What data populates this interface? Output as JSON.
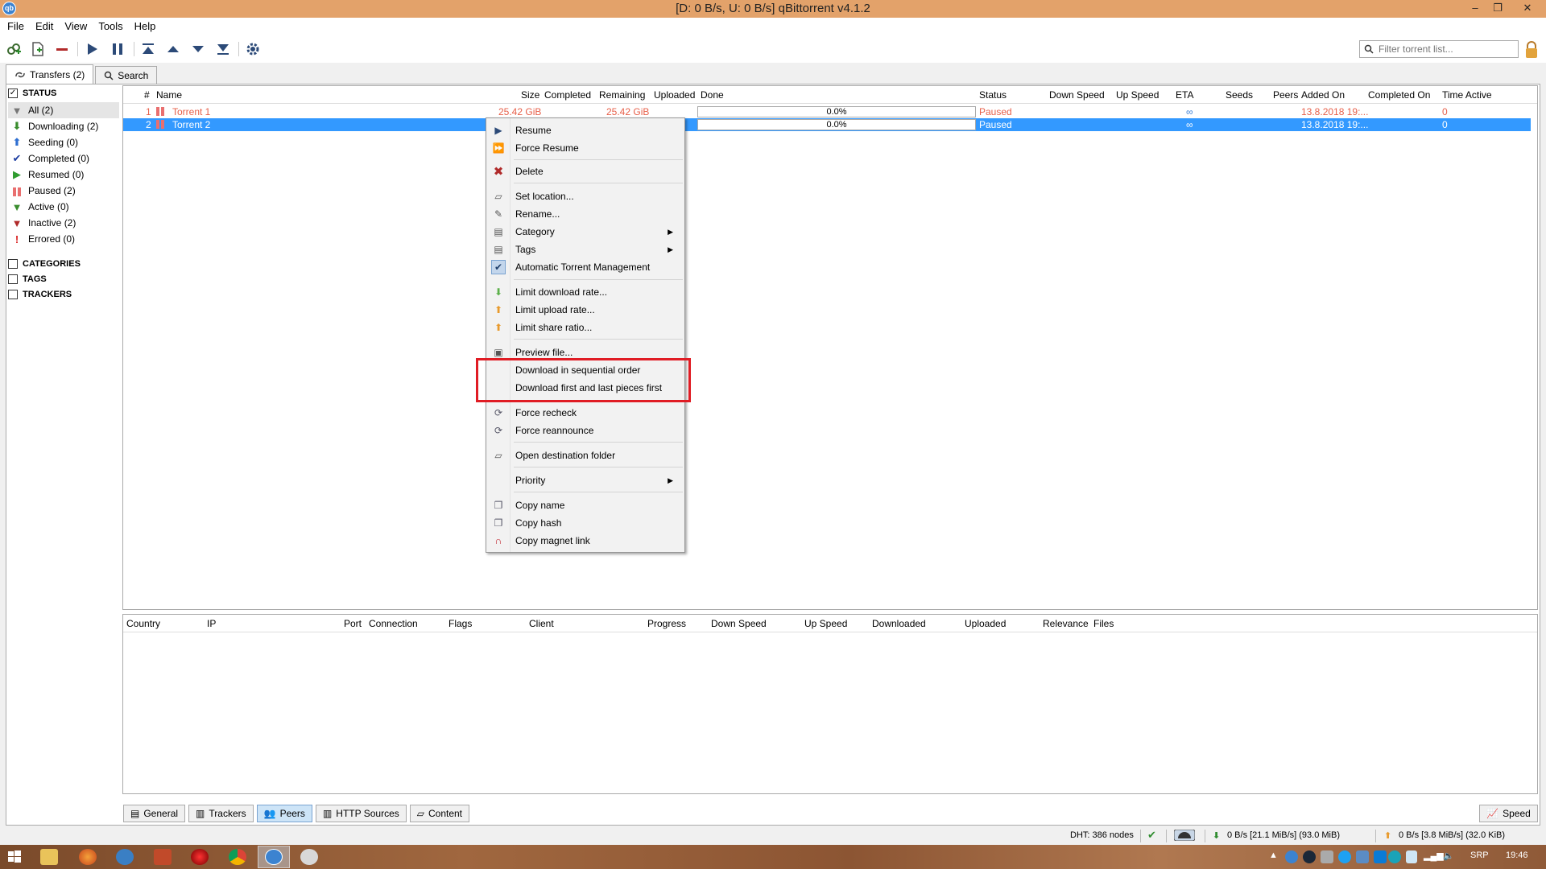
{
  "window": {
    "title": "[D: 0 B/s, U: 0 B/s] qBittorrent v4.1.2",
    "minimize": "–",
    "maximize": "❐",
    "close": "✕"
  },
  "menu": [
    "File",
    "Edit",
    "View",
    "Tools",
    "Help"
  ],
  "toolbar": {
    "filter_placeholder": "Filter torrent list..."
  },
  "tabs_top": [
    {
      "label": "Transfers (2)"
    },
    {
      "label": "Search"
    }
  ],
  "sidebar": {
    "status_header": "STATUS",
    "status_items": [
      {
        "label": "All (2)",
        "icon": "filter-icon",
        "color": "#777777"
      },
      {
        "label": "Downloading (2)",
        "icon": "down-arrow-icon",
        "color": "#3a8d2e"
      },
      {
        "label": "Seeding (0)",
        "icon": "up-arrow-icon",
        "color": "#2f6fd1"
      },
      {
        "label": "Completed (0)",
        "icon": "check-icon",
        "color": "#1f3fa3"
      },
      {
        "label": "Resumed (0)",
        "icon": "play-icon",
        "color": "#2f9c2f"
      },
      {
        "label": "Paused (2)",
        "icon": "pause-icon",
        "color": "#e96f6f"
      },
      {
        "label": "Active (0)",
        "icon": "filter-icon",
        "color": "#3a8d2e"
      },
      {
        "label": "Inactive (2)",
        "icon": "filter-icon",
        "color": "#b02a2a"
      },
      {
        "label": "Errored (0)",
        "icon": "exclamation-icon",
        "color": "#d92020"
      }
    ],
    "categories_header": "CATEGORIES",
    "tags_header": "TAGS",
    "trackers_header": "TRACKERS"
  },
  "torrent_list": {
    "columns": [
      "#",
      "Name",
      "Size",
      "Completed",
      "Remaining",
      "Uploaded",
      "Done",
      "Status",
      "Down Speed",
      "Up Speed",
      "ETA",
      "Seeds",
      "Peers",
      "Added On",
      "Completed On",
      "Time Active"
    ],
    "rows": [
      {
        "num": "1",
        "name": "Torrent 1",
        "size": "25.42 GiB",
        "remaining": "25.42 GiB",
        "done": "0.0%",
        "status": "Paused",
        "eta": "∞",
        "added": "13.8.2018 19:...",
        "time_active": "0"
      },
      {
        "num": "2",
        "name": "Torrent 2",
        "size": "",
        "remaining": "",
        "done": "0.0%",
        "status": "Paused",
        "eta": "∞",
        "added": "13.8.2018 19:...",
        "time_active": "0"
      }
    ]
  },
  "context_menu": {
    "items": [
      {
        "label": "Resume",
        "icon": "play-icon"
      },
      {
        "label": "Force Resume",
        "icon": "fast-forward-icon"
      },
      {
        "label": "Delete",
        "icon": "delete-x-icon"
      },
      {
        "label": "Set location...",
        "icon": "folder-icon"
      },
      {
        "label": "Rename...",
        "icon": "rename-icon"
      },
      {
        "label": "Category",
        "icon": "category-icon"
      },
      {
        "label": "Tags",
        "icon": "tags-icon"
      },
      {
        "label": "Automatic Torrent Management",
        "icon": "check-icon"
      },
      {
        "label": "Limit download rate...",
        "icon": "limit-download-icon"
      },
      {
        "label": "Limit upload rate...",
        "icon": "limit-upload-icon"
      },
      {
        "label": "Limit share ratio...",
        "icon": "limit-ratio-icon"
      },
      {
        "label": "Preview file...",
        "icon": "preview-icon"
      },
      {
        "label": "Download in sequential order",
        "icon": ""
      },
      {
        "label": "Download first and last pieces first",
        "icon": ""
      },
      {
        "label": "Force recheck",
        "icon": "recheck-icon"
      },
      {
        "label": "Force reannounce",
        "icon": "reannounce-icon"
      },
      {
        "label": "Open destination folder",
        "icon": "folder-open-icon"
      },
      {
        "label": "Priority",
        "icon": ""
      },
      {
        "label": "Copy name",
        "icon": "copy-icon"
      },
      {
        "label": "Copy hash",
        "icon": "copy-icon"
      },
      {
        "label": "Copy magnet link",
        "icon": "magnet-icon"
      }
    ]
  },
  "peers_list": {
    "columns": [
      "Country",
      "IP",
      "Port",
      "Connection",
      "Flags",
      "Client",
      "Progress",
      "Down Speed",
      "Up Speed",
      "Downloaded",
      "Uploaded",
      "Relevance",
      "Files"
    ]
  },
  "bottom_tabs": [
    "General",
    "Trackers",
    "Peers",
    "HTTP Sources",
    "Content"
  ],
  "speed_button": "Speed",
  "statusbar": {
    "dht": "DHT: 386 nodes",
    "download": "0 B/s [21.1 MiB/s] (93.0 MiB)",
    "upload": "0 B/s [3.8 MiB/s] (32.0 KiB)"
  },
  "taskbar": {
    "language": "SRP",
    "time": "19:46"
  }
}
